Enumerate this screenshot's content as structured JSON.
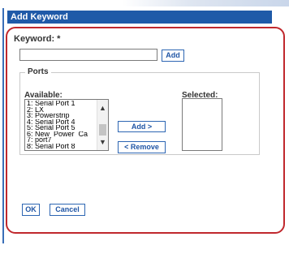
{
  "dialog": {
    "title": "Add Keyword"
  },
  "keyword": {
    "label": "Keyword: *",
    "value": "",
    "add_button": "Add"
  },
  "ports": {
    "legend": "Ports",
    "available_label": "Available:",
    "selected_label": "Selected:",
    "available": [
      "1: Serial Port 1",
      "2: LX",
      "3: Powerstrip",
      "4: Serial Port 4",
      "5: Serial Port 5",
      "6: New_Power_Ca",
      "7: port7",
      "8: Serial Port 8"
    ],
    "selected": [],
    "add_button": "Add >",
    "remove_button": "< Remove"
  },
  "footer": {
    "ok_button": "OK",
    "cancel_button": "Cancel"
  },
  "colors": {
    "title_bar": "#1f5aa8",
    "highlight_outline": "#c0282d",
    "button_border": "#2d66b3"
  },
  "icons": {
    "scroll_up": "chevron-up-icon",
    "scroll_down": "chevron-down-icon"
  }
}
